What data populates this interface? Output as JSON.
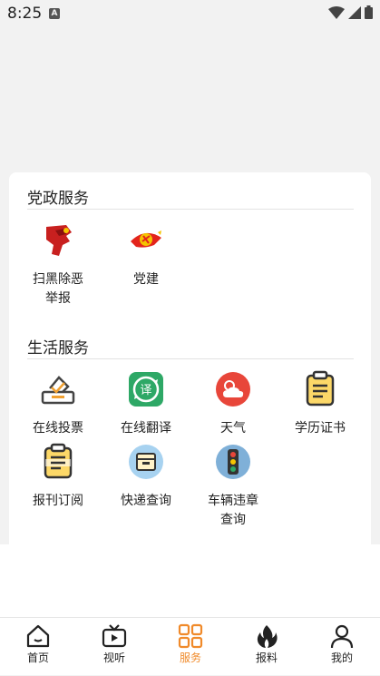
{
  "status": {
    "time": "8:25",
    "notif_icon": "A"
  },
  "sections": [
    {
      "title": "党政服务",
      "items": [
        {
          "label_line1": "扫黑除恶",
          "label_line2": "举报",
          "icon": "fist-icon"
        },
        {
          "label_line1": "党建",
          "label_line2": "",
          "icon": "party-emblem-icon"
        }
      ]
    },
    {
      "title": "生活服务",
      "items": [
        {
          "label_line1": "在线投票",
          "label_line2": "",
          "icon": "vote-box-icon"
        },
        {
          "label_line1": "在线翻译",
          "label_line2": "",
          "icon": "translate-icon"
        },
        {
          "label_line1": "天气",
          "label_line2": "",
          "icon": "weather-icon"
        },
        {
          "label_line1": "学历证书",
          "label_line2": "",
          "icon": "certificate-icon"
        },
        {
          "label_line1": "报刊订阅",
          "label_line2": "",
          "icon": "newspaper-icon"
        },
        {
          "label_line1": "快递查询",
          "label_line2": "",
          "icon": "parcel-icon"
        },
        {
          "label_line1": "车辆违章",
          "label_line2": "查询",
          "icon": "traffic-light-icon"
        }
      ]
    }
  ],
  "tabs": [
    {
      "label": "首页",
      "icon": "home-icon"
    },
    {
      "label": "视听",
      "icon": "tv-icon"
    },
    {
      "label": "服务",
      "icon": "grid-icon",
      "active": true
    },
    {
      "label": "报料",
      "icon": "flame-icon"
    },
    {
      "label": "我的",
      "icon": "user-icon"
    }
  ],
  "colors": {
    "accent": "#f08a2a",
    "text": "#222222"
  }
}
